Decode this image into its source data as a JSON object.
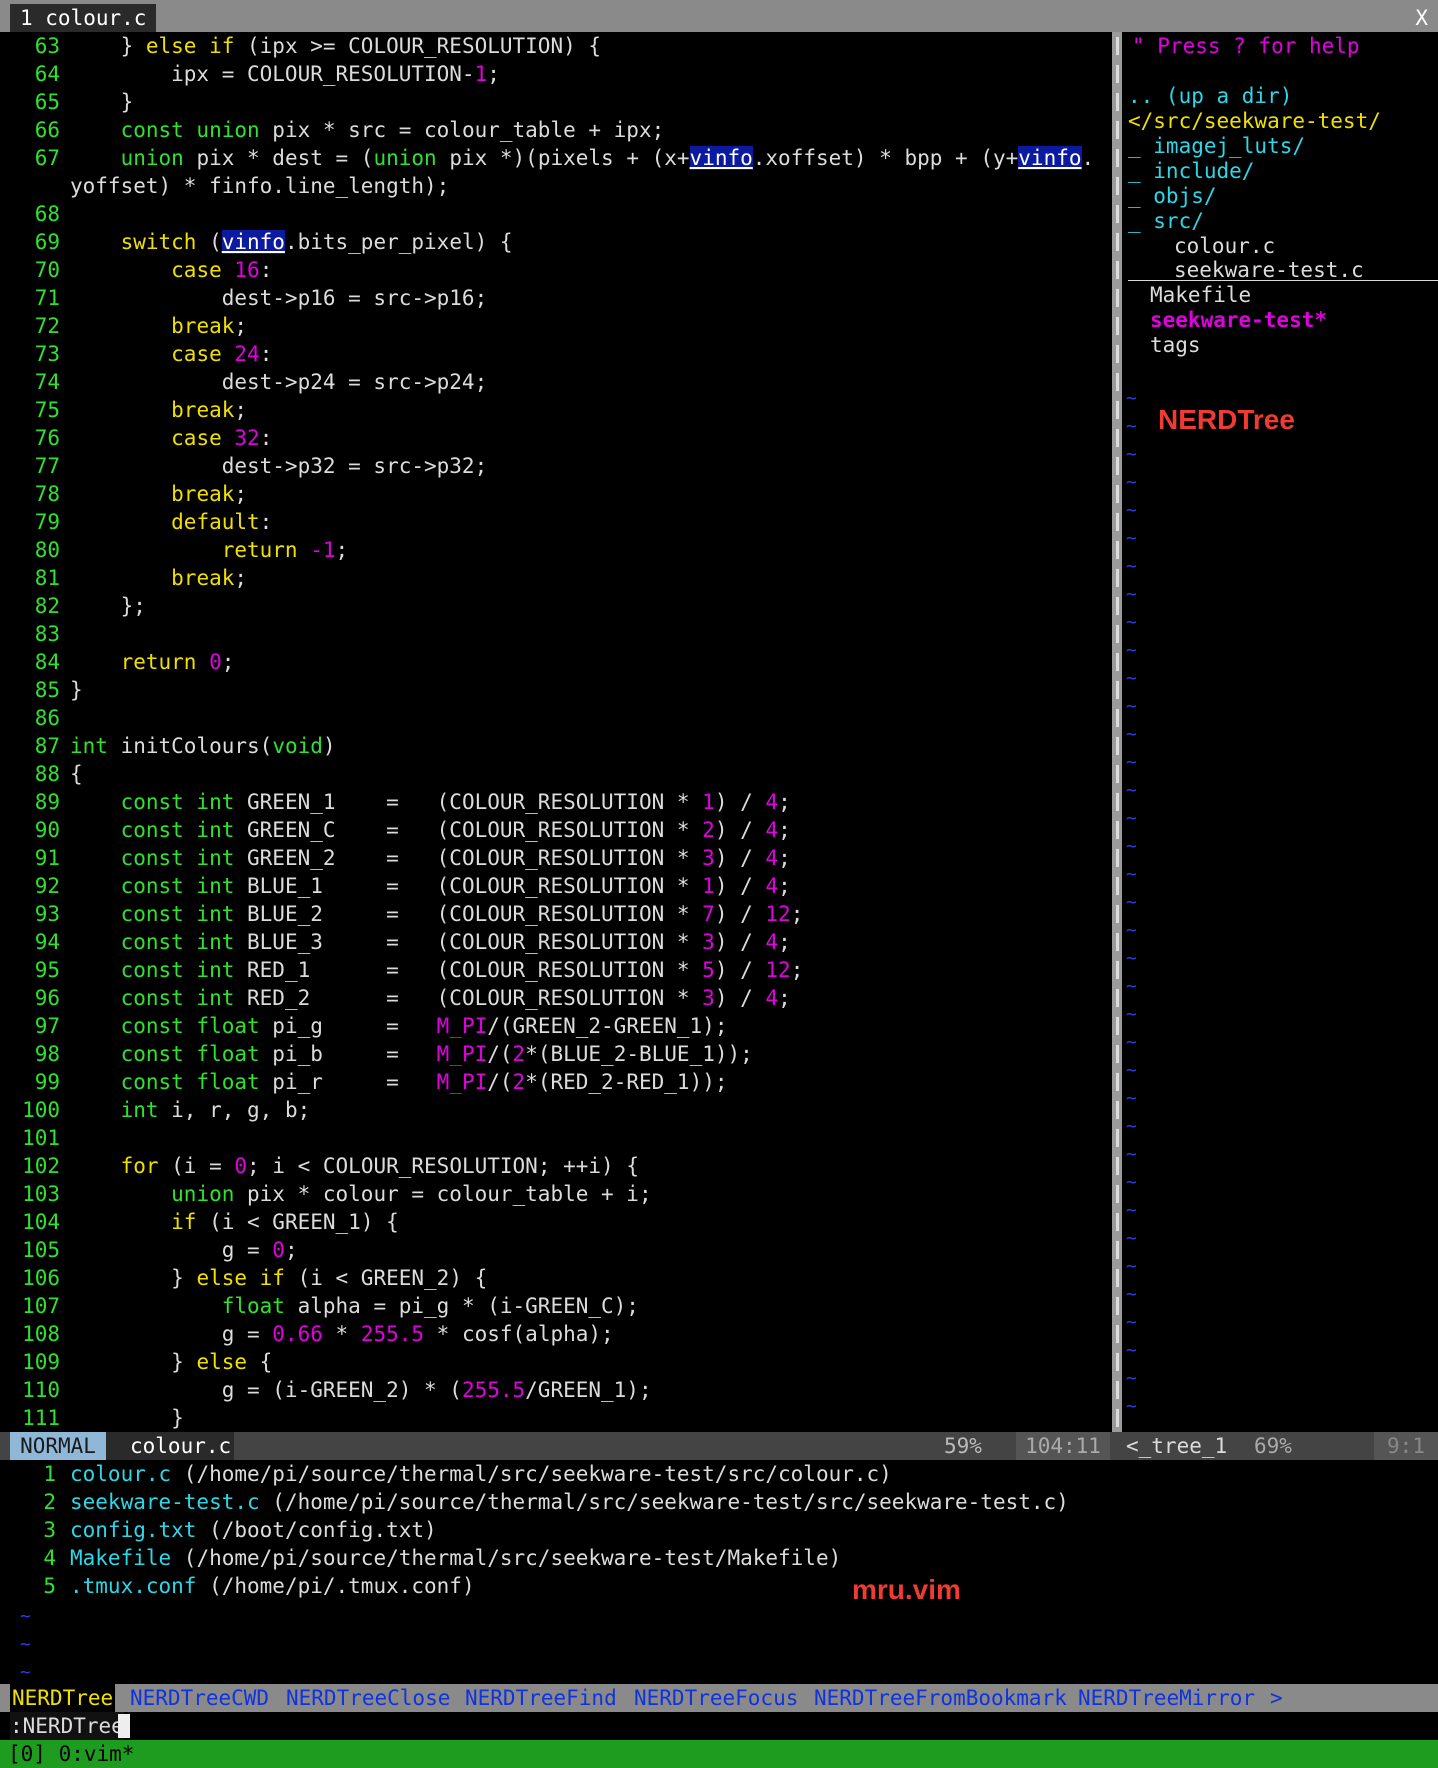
{
  "tabline": {
    "tab_label": "1 colour.c",
    "close": "X"
  },
  "code_lines": [
    {
      "n": "63",
      "segs": [
        [
          "    } ",
          "t"
        ],
        [
          "else if",
          "k"
        ],
        [
          " (ipx >= COLOUR_RESOLUTION) {",
          "t"
        ]
      ]
    },
    {
      "n": "64",
      "segs": [
        [
          "        ipx = COLOUR_RESOLUTION-",
          "t"
        ],
        [
          "1",
          "n"
        ],
        [
          ";",
          "t"
        ]
      ]
    },
    {
      "n": "65",
      "segs": [
        [
          "    }",
          "t"
        ]
      ]
    },
    {
      "n": "66",
      "segs": [
        [
          "    ",
          "t"
        ],
        [
          "const union",
          "y"
        ],
        [
          " pix * src = colour_table + ipx;",
          "t"
        ]
      ]
    },
    {
      "n": "67",
      "segs": [
        [
          "    ",
          "t"
        ],
        [
          "union",
          "y"
        ],
        [
          " pix * dest = (",
          "t"
        ],
        [
          "union",
          "y"
        ],
        [
          " pix *)(pixels + (x+",
          "t"
        ],
        [
          "vinfo",
          "h"
        ],
        [
          ".xoffset) * bpp + (y+",
          "t"
        ],
        [
          "vinfo",
          "h"
        ],
        [
          ".",
          "t"
        ]
      ]
    },
    {
      "n": "",
      "segs": [
        [
          "yoffset) * finfo.line_length);",
          "t"
        ]
      ]
    },
    {
      "n": "68",
      "segs": []
    },
    {
      "n": "69",
      "segs": [
        [
          "    ",
          "t"
        ],
        [
          "switch",
          "k"
        ],
        [
          " (",
          "t"
        ],
        [
          "vinfo",
          "h"
        ],
        [
          ".bits_per_pixel) {",
          "t"
        ]
      ]
    },
    {
      "n": "70",
      "segs": [
        [
          "        ",
          "t"
        ],
        [
          "case",
          "k"
        ],
        [
          " ",
          "t"
        ],
        [
          "16",
          "n"
        ],
        [
          ":",
          "t"
        ]
      ]
    },
    {
      "n": "71",
      "segs": [
        [
          "            dest->p16 = src->p16;",
          "t"
        ]
      ]
    },
    {
      "n": "72",
      "segs": [
        [
          "        ",
          "t"
        ],
        [
          "break",
          "k"
        ],
        [
          ";",
          "t"
        ]
      ]
    },
    {
      "n": "73",
      "segs": [
        [
          "        ",
          "t"
        ],
        [
          "case",
          "k"
        ],
        [
          " ",
          "t"
        ],
        [
          "24",
          "n"
        ],
        [
          ":",
          "t"
        ]
      ]
    },
    {
      "n": "74",
      "segs": [
        [
          "            dest->p24 = src->p24;",
          "t"
        ]
      ]
    },
    {
      "n": "75",
      "segs": [
        [
          "        ",
          "t"
        ],
        [
          "break",
          "k"
        ],
        [
          ";",
          "t"
        ]
      ]
    },
    {
      "n": "76",
      "segs": [
        [
          "        ",
          "t"
        ],
        [
          "case",
          "k"
        ],
        [
          " ",
          "t"
        ],
        [
          "32",
          "n"
        ],
        [
          ":",
          "t"
        ]
      ]
    },
    {
      "n": "77",
      "segs": [
        [
          "            dest->p32 = src->p32;",
          "t"
        ]
      ]
    },
    {
      "n": "78",
      "segs": [
        [
          "        ",
          "t"
        ],
        [
          "break",
          "k"
        ],
        [
          ";",
          "t"
        ]
      ]
    },
    {
      "n": "79",
      "segs": [
        [
          "        ",
          "t"
        ],
        [
          "default",
          "k"
        ],
        [
          ":",
          "t"
        ]
      ]
    },
    {
      "n": "80",
      "segs": [
        [
          "            ",
          "t"
        ],
        [
          "return",
          "k"
        ],
        [
          " ",
          "t"
        ],
        [
          "-1",
          "n"
        ],
        [
          ";",
          "t"
        ]
      ]
    },
    {
      "n": "81",
      "segs": [
        [
          "        ",
          "t"
        ],
        [
          "break",
          "k"
        ],
        [
          ";",
          "t"
        ]
      ]
    },
    {
      "n": "82",
      "segs": [
        [
          "    };",
          "t"
        ]
      ]
    },
    {
      "n": "83",
      "segs": []
    },
    {
      "n": "84",
      "segs": [
        [
          "    ",
          "t"
        ],
        [
          "return",
          "k"
        ],
        [
          " ",
          "t"
        ],
        [
          "0",
          "n"
        ],
        [
          ";",
          "t"
        ]
      ]
    },
    {
      "n": "85",
      "segs": [
        [
          "}",
          "t"
        ]
      ]
    },
    {
      "n": "86",
      "segs": []
    },
    {
      "n": "87",
      "segs": [
        [
          "int",
          "y"
        ],
        [
          " initColours(",
          "t"
        ],
        [
          "void",
          "y"
        ],
        [
          ")",
          "t"
        ]
      ]
    },
    {
      "n": "88",
      "segs": [
        [
          "{",
          "t"
        ]
      ]
    },
    {
      "n": "89",
      "segs": [
        [
          "    ",
          "t"
        ],
        [
          "const int",
          "y"
        ],
        [
          " GREEN_1    =   (COLOUR_RESOLUTION * ",
          "t"
        ],
        [
          "1",
          "n"
        ],
        [
          ") / ",
          "t"
        ],
        [
          "4",
          "n"
        ],
        [
          ";",
          "t"
        ]
      ]
    },
    {
      "n": "90",
      "segs": [
        [
          "    ",
          "t"
        ],
        [
          "const int",
          "y"
        ],
        [
          " GREEN_C    =   (COLOUR_RESOLUTION * ",
          "t"
        ],
        [
          "2",
          "n"
        ],
        [
          ") / ",
          "t"
        ],
        [
          "4",
          "n"
        ],
        [
          ";",
          "t"
        ]
      ]
    },
    {
      "n": "91",
      "segs": [
        [
          "    ",
          "t"
        ],
        [
          "const int",
          "y"
        ],
        [
          " GREEN_2    =   (COLOUR_RESOLUTION * ",
          "t"
        ],
        [
          "3",
          "n"
        ],
        [
          ") / ",
          "t"
        ],
        [
          "4",
          "n"
        ],
        [
          ";",
          "t"
        ]
      ]
    },
    {
      "n": "92",
      "segs": [
        [
          "    ",
          "t"
        ],
        [
          "const int",
          "y"
        ],
        [
          " BLUE_1     =   (COLOUR_RESOLUTION * ",
          "t"
        ],
        [
          "1",
          "n"
        ],
        [
          ") / ",
          "t"
        ],
        [
          "4",
          "n"
        ],
        [
          ";",
          "t"
        ]
      ]
    },
    {
      "n": "93",
      "segs": [
        [
          "    ",
          "t"
        ],
        [
          "const int",
          "y"
        ],
        [
          " BLUE_2     =   (COLOUR_RESOLUTION * ",
          "t"
        ],
        [
          "7",
          "n"
        ],
        [
          ") / ",
          "t"
        ],
        [
          "12",
          "n"
        ],
        [
          ";",
          "t"
        ]
      ]
    },
    {
      "n": "94",
      "segs": [
        [
          "    ",
          "t"
        ],
        [
          "const int",
          "y"
        ],
        [
          " BLUE_3     =   (COLOUR_RESOLUTION * ",
          "t"
        ],
        [
          "3",
          "n"
        ],
        [
          ") / ",
          "t"
        ],
        [
          "4",
          "n"
        ],
        [
          ";",
          "t"
        ]
      ]
    },
    {
      "n": "95",
      "segs": [
        [
          "    ",
          "t"
        ],
        [
          "const int",
          "y"
        ],
        [
          " RED_1      =   (COLOUR_RESOLUTION * ",
          "t"
        ],
        [
          "5",
          "n"
        ],
        [
          ") / ",
          "t"
        ],
        [
          "12",
          "n"
        ],
        [
          ";",
          "t"
        ]
      ]
    },
    {
      "n": "96",
      "segs": [
        [
          "    ",
          "t"
        ],
        [
          "const int",
          "y"
        ],
        [
          " RED_2      =   (COLOUR_RESOLUTION * ",
          "t"
        ],
        [
          "3",
          "n"
        ],
        [
          ") / ",
          "t"
        ],
        [
          "4",
          "n"
        ],
        [
          ";",
          "t"
        ]
      ]
    },
    {
      "n": "97",
      "segs": [
        [
          "    ",
          "t"
        ],
        [
          "const float",
          "y"
        ],
        [
          " pi_g     =   ",
          "t"
        ],
        [
          "M_PI",
          "n"
        ],
        [
          "/(GREEN_2-GREEN_1);",
          "t"
        ]
      ]
    },
    {
      "n": "98",
      "segs": [
        [
          "    ",
          "t"
        ],
        [
          "const float",
          "y"
        ],
        [
          " pi_b     =   ",
          "t"
        ],
        [
          "M_PI",
          "n"
        ],
        [
          "/(",
          "t"
        ],
        [
          "2",
          "n"
        ],
        [
          "*(BLUE_2-BLUE_1));",
          "t"
        ]
      ]
    },
    {
      "n": "99",
      "segs": [
        [
          "    ",
          "t"
        ],
        [
          "const float",
          "y"
        ],
        [
          " pi_r     =   ",
          "t"
        ],
        [
          "M_PI",
          "n"
        ],
        [
          "/(",
          "t"
        ],
        [
          "2",
          "n"
        ],
        [
          "*(RED_2-RED_1));",
          "t"
        ]
      ]
    },
    {
      "n": "100",
      "segs": [
        [
          "    ",
          "t"
        ],
        [
          "int",
          "y"
        ],
        [
          " i, r, g, b;",
          "t"
        ]
      ]
    },
    {
      "n": "101",
      "segs": []
    },
    {
      "n": "102",
      "segs": [
        [
          "    ",
          "t"
        ],
        [
          "for",
          "k"
        ],
        [
          " (i = ",
          "t"
        ],
        [
          "0",
          "n"
        ],
        [
          "; i < COLOUR_RESOLUTION; ++i) {",
          "t"
        ]
      ]
    },
    {
      "n": "103",
      "segs": [
        [
          "        ",
          "t"
        ],
        [
          "union",
          "y"
        ],
        [
          " pix * colour = colour_table + i;",
          "t"
        ]
      ]
    },
    {
      "n": "104",
      "segs": [
        [
          "        ",
          "t"
        ],
        [
          "if",
          "k"
        ],
        [
          " (i < GREEN_1) {",
          "t"
        ]
      ]
    },
    {
      "n": "105",
      "segs": [
        [
          "            g = ",
          "t"
        ],
        [
          "0",
          "n"
        ],
        [
          ";",
          "t"
        ]
      ]
    },
    {
      "n": "106",
      "segs": [
        [
          "        } ",
          "t"
        ],
        [
          "else if",
          "k"
        ],
        [
          " (i < GREEN_2) {",
          "t"
        ]
      ]
    },
    {
      "n": "107",
      "segs": [
        [
          "            ",
          "t"
        ],
        [
          "float",
          "y"
        ],
        [
          " alpha = pi_g * (i-GREEN_C);",
          "t"
        ]
      ]
    },
    {
      "n": "108",
      "segs": [
        [
          "            g = ",
          "t"
        ],
        [
          "0.66",
          "n"
        ],
        [
          " * ",
          "t"
        ],
        [
          "255.5",
          "n"
        ],
        [
          " * cosf(alpha);",
          "t"
        ]
      ]
    },
    {
      "n": "109",
      "segs": [
        [
          "        } ",
          "t"
        ],
        [
          "else",
          "k"
        ],
        [
          " {",
          "t"
        ]
      ]
    },
    {
      "n": "110",
      "segs": [
        [
          "            g = (i-GREEN_2) * (",
          "t"
        ],
        [
          "255.5",
          "n"
        ],
        [
          "/GREEN_1);",
          "t"
        ]
      ]
    },
    {
      "n": "111",
      "segs": [
        [
          "        }",
          "t"
        ]
      ]
    }
  ],
  "tree": {
    "help": "\" Press ? for help",
    "updir": ".. (up a dir)",
    "cwd": "</src/seekware-test/",
    "dirs": [
      "_ imagej_luts/",
      "_ include/",
      "_ objs/",
      "_ src/"
    ],
    "src_files": [
      "colour.c",
      "seekware-test.c"
    ],
    "files": [
      "Makefile"
    ],
    "exec": "seekware-test*",
    "tags": "tags",
    "annotation": "NERDTree"
  },
  "status": {
    "mode": "NORMAL",
    "filename": "colour.c",
    "percent": "59%",
    "position": "104:11",
    "tree_name": "<_tree_1",
    "tree_percent": "69%",
    "tree_position": "9:1"
  },
  "mru": {
    "items": [
      {
        "num": "1",
        "name": "colour.c",
        "path": " (/home/pi/source/thermal/src/seekware-test/src/colour.c)"
      },
      {
        "num": "2",
        "name": "seekware-test.c",
        "path": " (/home/pi/source/thermal/src/seekware-test/src/seekware-test.c)"
      },
      {
        "num": "3",
        "name": "config.txt",
        "path": " (/boot/config.txt)"
      },
      {
        "num": "4",
        "name": "Makefile",
        "path": " (/home/pi/source/thermal/src/seekware-test/Makefile)"
      },
      {
        "num": "5",
        "name": ".tmux.conf",
        "path": " (/home/pi/.tmux.conf)"
      }
    ],
    "annotation": "mru.vim"
  },
  "wildmenu": {
    "selected": "NERDTree",
    "items": [
      "NERDTreeCWD",
      "NERDTreeClose",
      "NERDTreeFind",
      "NERDTreeFocus",
      "NERDTreeFromBookmark",
      "NERDTreeMirror",
      ">"
    ]
  },
  "cmdline": ":NERDTree",
  "tmux": "[0] 0:vim*"
}
